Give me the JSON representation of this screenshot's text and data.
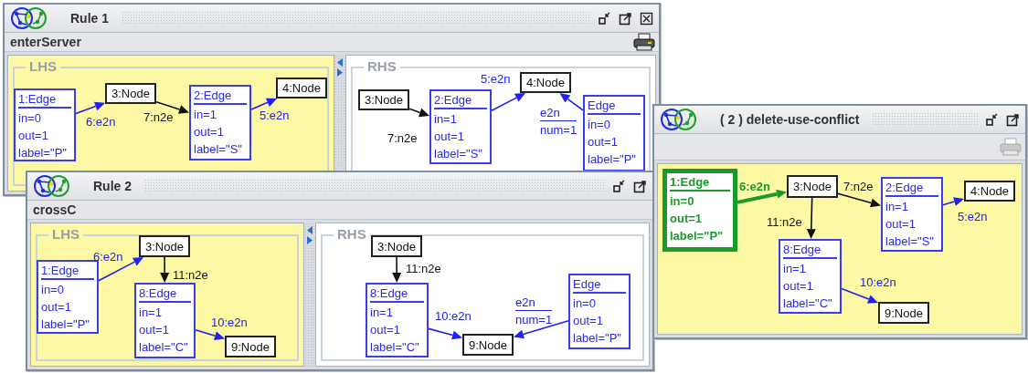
{
  "windows": [
    {
      "title": "Rule 1",
      "closable": true,
      "rule_name": "enterServer",
      "printer": {
        "enabled": true
      },
      "panels": [
        {
          "label": "LHS",
          "objects": [
            {
              "kind": "edge",
              "name": "1:Edge",
              "attributes": [
                "in=0",
                "out=1",
                "label=\"P\""
              ],
              "highlighted": false
            },
            {
              "kind": "node",
              "name": "3:Node",
              "highlighted": false
            },
            {
              "kind": "edge",
              "name": "2:Edge",
              "attributes": [
                "in=1",
                "out=1",
                "label=\"S\""
              ],
              "highlighted": false
            },
            {
              "kind": "node",
              "name": "4:Node",
              "highlighted": false
            }
          ],
          "links": [
            {
              "kind": "e2n",
              "label": "6:e2n",
              "highlighted": false
            },
            {
              "kind": "n2e",
              "label": "7:n2e",
              "highlighted": false
            },
            {
              "kind": "e2n",
              "label": "5:e2n",
              "highlighted": false
            }
          ]
        },
        {
          "label": "RHS",
          "objects": [
            {
              "kind": "node",
              "name": "3:Node",
              "highlighted": false
            },
            {
              "kind": "edge",
              "name": "2:Edge",
              "attributes": [
                "in=1",
                "out=1",
                "label=\"S\""
              ],
              "highlighted": false
            },
            {
              "kind": "node",
              "name": "4:Node",
              "highlighted": false
            },
            {
              "kind": "edge",
              "name": "Edge",
              "attributes": [
                "in=0",
                "out=1",
                "label=\"P\""
              ],
              "highlighted": false
            }
          ],
          "links": [
            {
              "kind": "n2e",
              "label": "7:n2e",
              "highlighted": false
            },
            {
              "kind": "e2n",
              "label": "5:e2n",
              "highlighted": false
            },
            {
              "kind": "e2n",
              "label": "e2n",
              "attributes": [
                "num=1"
              ],
              "highlighted": false
            }
          ]
        }
      ]
    },
    {
      "title": "Rule 2",
      "closable": false,
      "rule_name": "crossC",
      "panels": [
        {
          "label": "LHS",
          "objects": [
            {
              "kind": "edge",
              "name": "1:Edge",
              "attributes": [
                "in=0",
                "out=1",
                "label=\"P\""
              ],
              "highlighted": false
            },
            {
              "kind": "node",
              "name": "3:Node",
              "highlighted": false
            },
            {
              "kind": "edge",
              "name": "8:Edge",
              "attributes": [
                "in=1",
                "out=1",
                "label=\"C\""
              ],
              "highlighted": false
            },
            {
              "kind": "node",
              "name": "9:Node",
              "highlighted": false
            }
          ],
          "links": [
            {
              "kind": "e2n",
              "label": "6:e2n",
              "highlighted": false
            },
            {
              "kind": "n2e",
              "label": "11:n2e",
              "highlighted": false
            },
            {
              "kind": "e2n",
              "label": "10:e2n",
              "highlighted": false
            }
          ]
        },
        {
          "label": "RHS",
          "objects": [
            {
              "kind": "node",
              "name": "3:Node",
              "highlighted": false
            },
            {
              "kind": "edge",
              "name": "8:Edge",
              "attributes": [
                "in=1",
                "out=1",
                "label=\"C\""
              ],
              "highlighted": false
            },
            {
              "kind": "node",
              "name": "9:Node",
              "highlighted": false
            },
            {
              "kind": "edge",
              "name": "Edge",
              "attributes": [
                "in=0",
                "out=1",
                "label=\"P\""
              ],
              "highlighted": false
            }
          ],
          "links": [
            {
              "kind": "n2e",
              "label": "11:n2e",
              "highlighted": false
            },
            {
              "kind": "e2n",
              "label": "10:e2n",
              "highlighted": false
            },
            {
              "kind": "e2n",
              "label": "e2n",
              "attributes": [
                "num=1"
              ],
              "highlighted": false
            }
          ]
        }
      ]
    },
    {
      "title": "( 2 ) delete-use-conflict",
      "closable": false,
      "printer": {
        "enabled": false
      },
      "panels": [
        {
          "objects": [
            {
              "kind": "edge",
              "name": "1:Edge",
              "attributes": [
                "in=0",
                "out=1",
                "label=\"P\""
              ],
              "highlighted": true
            },
            {
              "kind": "node",
              "name": "3:Node",
              "highlighted": false
            },
            {
              "kind": "edge",
              "name": "2:Edge",
              "attributes": [
                "in=1",
                "out=1",
                "label=\"S\""
              ],
              "highlighted": false
            },
            {
              "kind": "node",
              "name": "4:Node",
              "highlighted": false
            },
            {
              "kind": "edge",
              "name": "8:Edge",
              "attributes": [
                "in=1",
                "out=1",
                "label=\"C\""
              ],
              "highlighted": false
            },
            {
              "kind": "node",
              "name": "9:Node",
              "highlighted": false
            }
          ],
          "links": [
            {
              "kind": "e2n",
              "label": "6:e2n",
              "highlighted": true
            },
            {
              "kind": "n2e",
              "label": "7:n2e",
              "highlighted": false
            },
            {
              "kind": "e2n",
              "label": "5:e2n",
              "highlighted": false
            },
            {
              "kind": "n2e",
              "label": "11:n2e",
              "highlighted": false
            },
            {
              "kind": "e2n",
              "label": "10:e2n",
              "highlighted": false
            }
          ]
        }
      ]
    }
  ]
}
